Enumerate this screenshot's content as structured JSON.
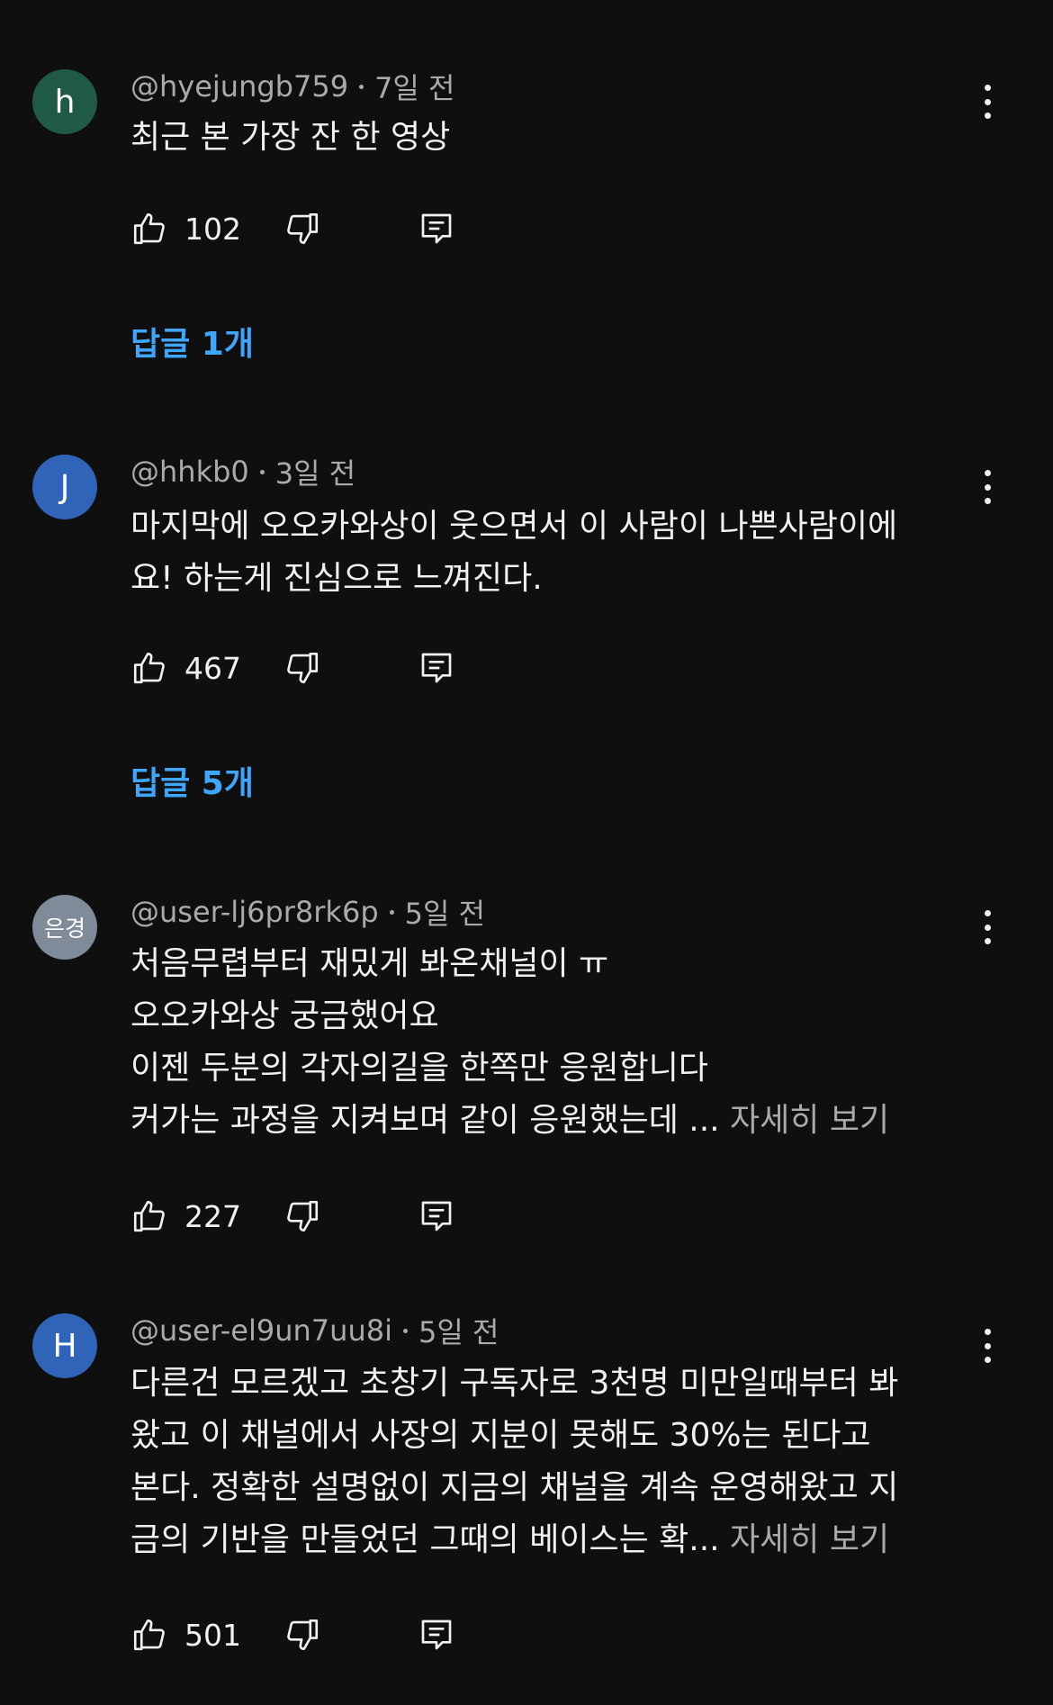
{
  "comments": [
    {
      "avatar_letter": "h",
      "avatar_color": "#1f5a47",
      "author": "@hyejungb759",
      "time": "7일 전",
      "lines": [
        "최근 본 가장 잔   한 영상"
      ],
      "more": "",
      "likes": "102",
      "replies": "답글 1개"
    },
    {
      "avatar_letter": "J",
      "avatar_color": "#2f64b8",
      "author": "@hhkb0",
      "time": "3일 전",
      "lines": [
        "마지막에 오오카와상이 웃으면서 이 사람이 나쁜사람이에",
        "요! 하는게 진심으로 느껴진다."
      ],
      "more": "",
      "likes": "467",
      "replies": "답글 5개"
    },
    {
      "avatar_letter": "은경",
      "avatar_color": "#7f8b98",
      "author": "@user-lj6pr8rk6p",
      "time": "5일 전",
      "lines": [
        "처음무렵부터 재밌게 봐온채널이 ㅠ",
        "오오카와상 궁금했어요",
        "이젠 두분의 각자의길을 한쪽만 응원합니다",
        "커가는 과정을 지켜보며 같이 응원했는데 ..."
      ],
      "more": "자세히 보기",
      "likes": "227",
      "replies": ""
    },
    {
      "avatar_letter": "H",
      "avatar_color": "#2f64b8",
      "author": "@user-el9un7uu8i",
      "time": "5일 전",
      "lines": [
        "다른건 모르겠고 초창기 구독자로 3천명 미만일때부터 봐",
        "왔고 이 채널에서 사장의 지분이 못해도 30%는 된다고",
        "본다. 정확한 설명없이 지금의 채널을 계속 운영해왔고 지",
        "금의 기반을 만들었던 그때의 베이스는 확..."
      ],
      "more": "자세히 보기",
      "likes": "501",
      "replies": ""
    }
  ],
  "icons": {
    "like": "thumbs-up-icon",
    "dislike": "thumbs-down-icon",
    "reply": "comment-icon",
    "menu": "more-vertical-icon"
  }
}
